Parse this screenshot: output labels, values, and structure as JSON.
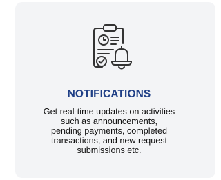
{
  "card": {
    "icon": "checklist-alarm-bell-icon",
    "title": "NOTIFICATIONS",
    "description_lines": [
      "Get real-time updates on activities",
      "such as announcements,",
      "pending payments, completed",
      "transactions, and new request",
      "submissions etc."
    ]
  },
  "colors": {
    "card_background": "#f3f4f6",
    "title": "#1f3f86",
    "icon_stroke": "#333333",
    "body_text": "#111111"
  }
}
